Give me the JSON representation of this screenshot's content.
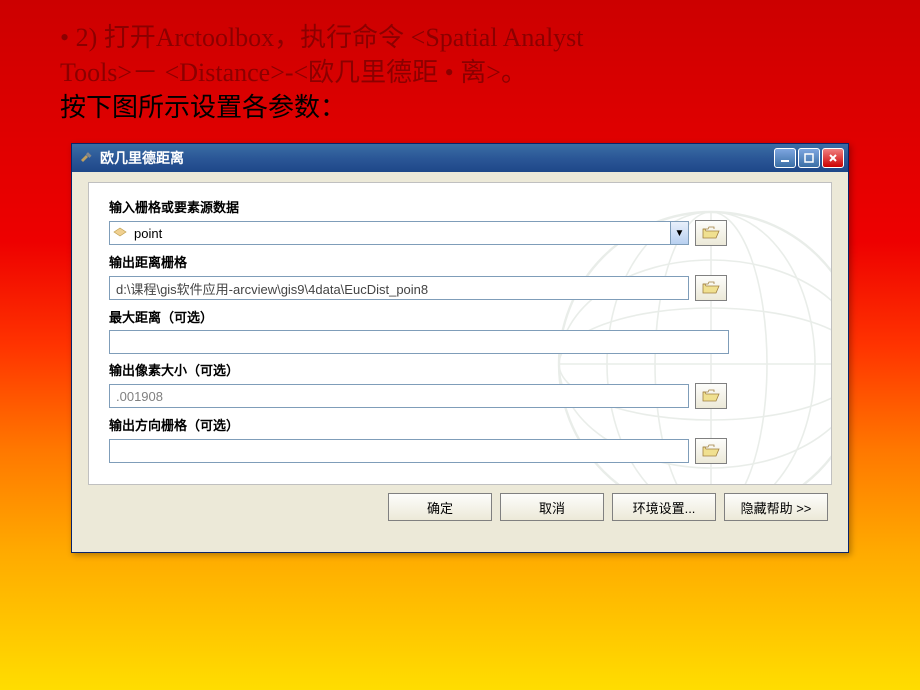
{
  "slide": {
    "line1a": "• 2) 打开Arctoolbox，执行命令 <Spatial Analyst",
    "line1b": "Tools>－ <Distance>-<欧几里德距 • 离>。",
    "line2": "按下图所示设置各参数："
  },
  "dialog": {
    "title": "欧几里德距离",
    "fields": {
      "input_source_label": "输入栅格或要素源数据",
      "input_source_value": "point",
      "output_distance_label": "输出距离栅格",
      "output_distance_value": "d:\\课程\\gis软件应用-arcview\\gis9\\4data\\EucDist_poin8",
      "max_distance_label": "最大距离（可选）",
      "max_distance_value": "",
      "output_cellsize_label": "输出像素大小（可选）",
      "output_cellsize_value": ".001908",
      "output_direction_label": "输出方向栅格（可选）",
      "output_direction_value": ""
    },
    "buttons": {
      "ok": "确定",
      "cancel": "取消",
      "env": "环境设置...",
      "hide_help": "隐藏帮助 >>"
    }
  }
}
